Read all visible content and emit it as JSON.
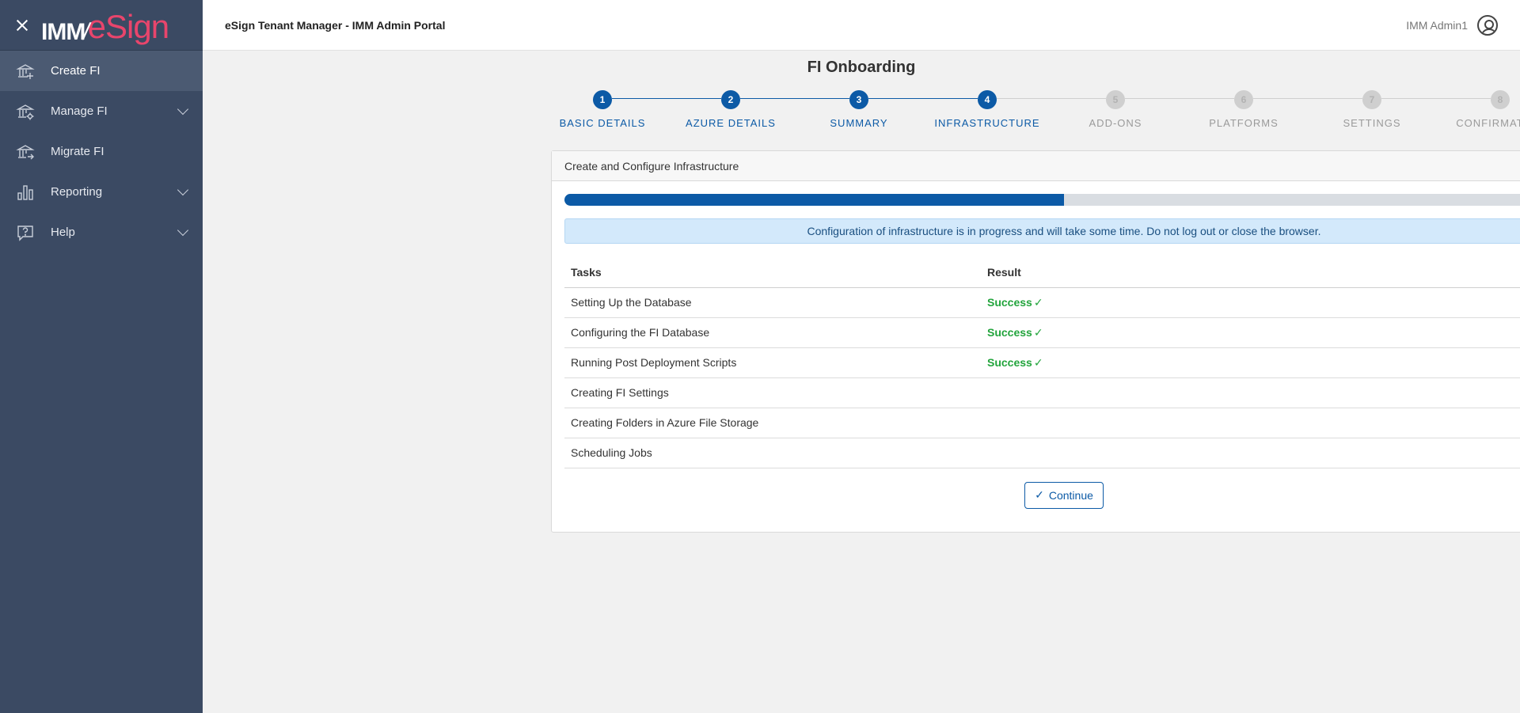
{
  "app": {
    "title": "eSign Tenant Manager - IMM Admin Portal",
    "logo_left": "IMM",
    "logo_right": "eSign",
    "user_name": "IMM Admin1"
  },
  "sidebar": {
    "items": [
      {
        "label": "Create FI",
        "icon": "bank-plus-icon",
        "active": true,
        "expandable": false
      },
      {
        "label": "Manage FI",
        "icon": "bank-gear-icon",
        "active": false,
        "expandable": true
      },
      {
        "label": "Migrate FI",
        "icon": "bank-arrow-icon",
        "active": false,
        "expandable": false
      },
      {
        "label": "Reporting",
        "icon": "bar-chart-icon",
        "active": false,
        "expandable": true
      },
      {
        "label": "Help",
        "icon": "help-icon",
        "active": false,
        "expandable": true
      }
    ]
  },
  "page": {
    "title": "FI Onboarding"
  },
  "steps": [
    {
      "num": "1",
      "label": "BASIC DETAILS",
      "state": "done"
    },
    {
      "num": "2",
      "label": "AZURE DETAILS",
      "state": "done"
    },
    {
      "num": "3",
      "label": "SUMMARY",
      "state": "done"
    },
    {
      "num": "4",
      "label": "INFRASTRUCTURE",
      "state": "done"
    },
    {
      "num": "5",
      "label": "ADD-ONS",
      "state": "todo"
    },
    {
      "num": "6",
      "label": "PLATFORMS",
      "state": "todo"
    },
    {
      "num": "7",
      "label": "SETTINGS",
      "state": "todo"
    },
    {
      "num": "8",
      "label": "CONFIRMATION",
      "state": "todo"
    }
  ],
  "card": {
    "title": "Create and Configure Infrastructure",
    "progress_percent": 50,
    "alert": "Configuration of infrastructure is in progress and will take some time. Do not log out or close the browser.",
    "columns": {
      "task": "Tasks",
      "result": "Result"
    },
    "tasks": [
      {
        "task": "Setting Up the Database",
        "result": "Success"
      },
      {
        "task": "Configuring the FI Database",
        "result": "Success"
      },
      {
        "task": "Running Post Deployment Scripts",
        "result": "Success"
      },
      {
        "task": "Creating FI Settings",
        "result": ""
      },
      {
        "task": "Creating Folders in Azure File Storage",
        "result": ""
      },
      {
        "task": "Scheduling Jobs",
        "result": ""
      }
    ],
    "continue_label": "Continue"
  },
  "colors": {
    "primary": "#0c5aa6",
    "sidebar": "#3b4a63",
    "success": "#22a43c"
  }
}
